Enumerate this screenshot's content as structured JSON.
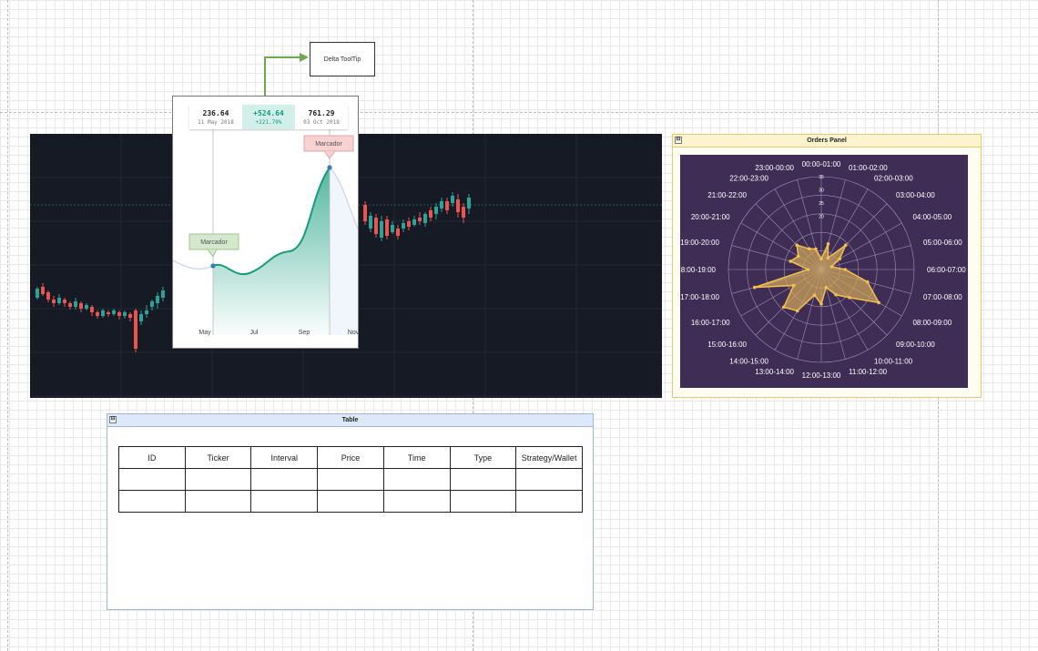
{
  "tooltip_note": {
    "label": "Delta ToolTip"
  },
  "area_chart": {
    "header": {
      "left": {
        "value": "236.64",
        "date": "11 May 2018"
      },
      "mid": {
        "value": "+524.64",
        "pct": "+221.70%"
      },
      "right": {
        "value": "761.29",
        "date": "03 Oct 2018"
      }
    },
    "marker_labels": [
      "Marcador",
      "Marcador"
    ],
    "x_ticks": [
      "May",
      "Jul",
      "Sep",
      "Nov"
    ]
  },
  "orders_panel": {
    "title": "Orders Panel",
    "collapse_glyph": "⊟"
  },
  "table_panel": {
    "title": "Table",
    "collapse_glyph": "⊟",
    "columns": [
      "ID",
      "Ticker",
      "Interval",
      "Price",
      "Time",
      "Type",
      "Strategy/Wallet"
    ],
    "rows": [
      [
        "",
        "",
        "",
        "",
        "",
        "",
        ""
      ],
      [
        "",
        "",
        "",
        "",
        "",
        "",
        ""
      ]
    ]
  },
  "colors": {
    "up": "#26a69a",
    "down": "#ef5350",
    "candle_bg": "#161a25",
    "radar_bg": "#3f2d55",
    "radar_fill": "#d4a85a",
    "radar_stroke": "#f2c14e",
    "area_line": "#169c7b",
    "arrow": "#6fa84f"
  },
  "chart_data": [
    {
      "type": "radar",
      "categories": [
        "00:00-01:00",
        "01:00-02:00",
        "02:00-03:00",
        "03:00-04:00",
        "04:00-05:00",
        "05:00-06:00",
        "06:00-07:00",
        "07:00-08:00",
        "08:00-09:00",
        "09:00-10:00",
        "10:00-11:00",
        "11:00-12:00",
        "12:00-13:00",
        "13:00-14:00",
        "14:00-15:00",
        "15:00-16:00",
        "16:00-17:00",
        "17:00-18:00",
        "18:00-19:00",
        "19:00-20:00",
        "20:00-21:00",
        "21:00-22:00",
        "22:00-23:00",
        "23:00-00:00"
      ],
      "values": [
        4,
        10,
        5,
        13,
        8,
        4,
        9,
        18,
        25,
        15,
        11,
        7,
        13,
        10,
        18,
        20,
        12,
        26,
        5,
        12,
        10,
        13,
        9,
        8
      ],
      "r_ticks": [
        "20",
        "25",
        "30",
        "35"
      ],
      "rlim": [
        0,
        35
      ]
    },
    {
      "type": "area",
      "x_ticks": [
        "May",
        "Jul",
        "Sep",
        "Nov"
      ],
      "start": {
        "date": "11 May 2018",
        "value": 236.64
      },
      "end": {
        "date": "03 Oct 2018",
        "value": 761.29
      }
    },
    {
      "type": "candlestick",
      "note": "dark candlestick chart without axis labels"
    }
  ]
}
